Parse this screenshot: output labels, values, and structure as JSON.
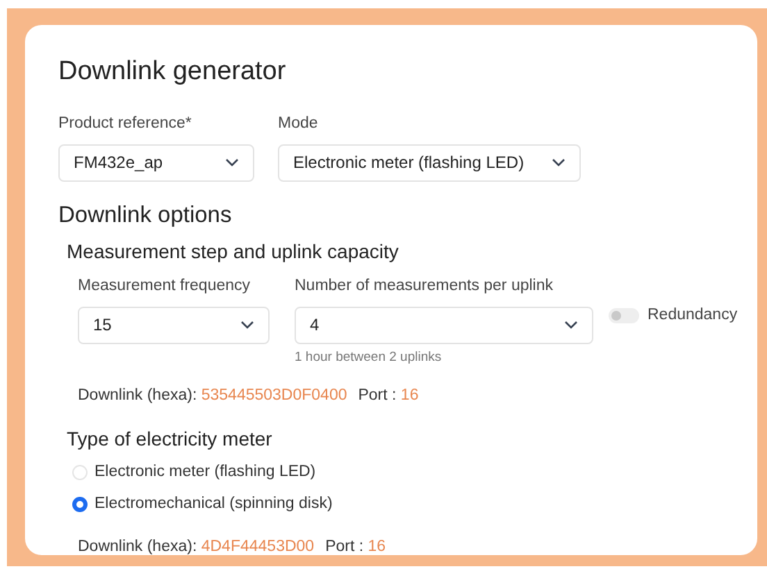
{
  "title": "Downlink generator",
  "fields": [
    {
      "label": "Product reference*",
      "value": "FM432e_ap"
    },
    {
      "label": "Mode",
      "value": "Electronic meter (flashing LED)"
    }
  ],
  "options_heading": "Downlink options",
  "measurement": {
    "heading": "Measurement step and uplink capacity",
    "frequency": {
      "label": "Measurement frequency",
      "value": "15"
    },
    "per_uplink": {
      "label": "Number of measurements per uplink",
      "value": "4",
      "helper": "1 hour between 2 uplinks"
    },
    "redundancy": {
      "label": "Redundancy",
      "on": false
    },
    "downlink": {
      "label": "Downlink (hexa):",
      "value": "535445503D0F0400",
      "port_label": "Port :",
      "port": "16"
    }
  },
  "meter_type": {
    "heading": "Type of electricity meter",
    "options": [
      {
        "label": "Electronic meter (flashing LED)",
        "selected": false
      },
      {
        "label": "Electromechanical (spinning disk)",
        "selected": true
      }
    ],
    "downlink": {
      "label": "Downlink (hexa):",
      "value": "4D4F44453D00",
      "port_label": "Port :",
      "port": "16"
    }
  }
}
